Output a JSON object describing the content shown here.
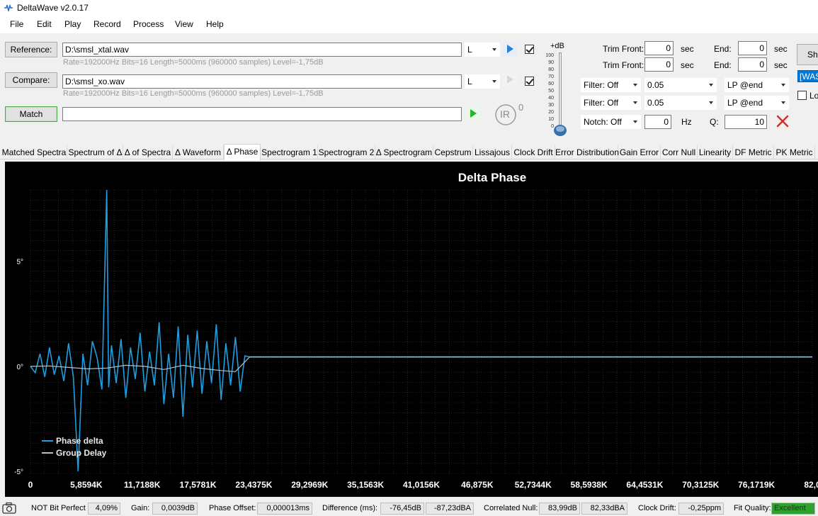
{
  "window": {
    "title": "DeltaWave v2.0.17"
  },
  "menu": [
    "File",
    "Edit",
    "Play",
    "Record",
    "Process",
    "View",
    "Help"
  ],
  "reference": {
    "button": "Reference:",
    "path": "D:\\smsl_xtal.wav",
    "channel": "L",
    "info": "Rate=192000Hz Bits=16 Length=5000ms (960000 samples) Level=-1,75dB",
    "checked": true
  },
  "compare": {
    "button": "Compare:",
    "path": "D:\\smsl_xo.wav",
    "channel": "L",
    "info": "Rate=192000Hz Bits=16 Length=5000ms (960000 samples) Level=-1,75dB",
    "checked": true
  },
  "match": {
    "button": "Match",
    "field": ""
  },
  "ir": {
    "label": "IR",
    "superscript": "0"
  },
  "db_slider": {
    "label": "+dB",
    "ticks": [
      "100",
      "90",
      "80",
      "70",
      "60",
      "50",
      "40",
      "30",
      "20",
      "10",
      "0"
    ],
    "value": 0
  },
  "trim": [
    {
      "label": "Trim Front:",
      "value": "0",
      "unit": "sec",
      "end_label": "End:",
      "end_value": "0",
      "end_unit": "sec"
    },
    {
      "label": "Trim Front:",
      "value": "0",
      "unit": "sec",
      "end_label": "End:",
      "end_value": "0",
      "end_unit": "sec"
    }
  ],
  "filters": [
    {
      "filter": "Filter: Off",
      "value": "0.05",
      "mode": "LP @end"
    },
    {
      "filter": "Filter: Off",
      "value": "0.05",
      "mode": "LP @end"
    }
  ],
  "notch": {
    "label": "Notch: Off",
    "value": "0",
    "unit": "Hz",
    "q_label": "Q:",
    "q_value": "10"
  },
  "right_edge": {
    "button": "Sh",
    "selected": "[WAS",
    "checkbox_label": "Lo"
  },
  "tabs": [
    "Matched Spectra",
    "Spectrum of Δ",
    "Δ of Spectra",
    "Δ Waveform",
    "Δ Phase",
    "Spectrogram 1",
    "Spectrogram 2",
    "Δ Spectrogram",
    "Cepstrum",
    "Lissajous",
    "Clock Drift",
    "Error Distribution",
    "Gain Error",
    "Corr Null",
    "Linearity",
    "DF Metric",
    "PK Metric"
  ],
  "active_tab": 4,
  "colors": {
    "phase_delta": "#1e9ee0",
    "group_delay": "#bfbfbf",
    "grid": "#3a3a3a",
    "background": "#000000",
    "fit_quality": "#2ea12e"
  },
  "chart_data": {
    "type": "line",
    "title": "Delta Phase",
    "xlabel": "",
    "ylabel": "",
    "x_tick_labels": [
      "0",
      "5,8594K",
      "11,7188K",
      "17,5781K",
      "23,4375K",
      "29,2969K",
      "35,1563K",
      "41,0156K",
      "46,875K",
      "52,7344K",
      "58,5938K",
      "64,4531K",
      "70,3125K",
      "76,1719K",
      "82,0"
    ],
    "x_ticks": [
      0,
      5859.4,
      11718.8,
      17578.1,
      23437.5,
      29296.9,
      35156.3,
      41015.6,
      46875,
      52734.4,
      58593.8,
      64453.1,
      70312.5,
      76171.9,
      82031.3
    ],
    "y_tick_labels": [
      "5°",
      "0°",
      "-5°"
    ],
    "y_ticks": [
      5,
      0,
      -5
    ],
    "xlim": [
      0,
      82031.3
    ],
    "ylim": [
      -5.1,
      8.4
    ],
    "grid": true,
    "legend_position": "bottom-left",
    "series": [
      {
        "name": "Phase delta",
        "x": [
          0,
          500,
          1000,
          1500,
          2000,
          2500,
          3000,
          3500,
          4000,
          4500,
          5000,
          5500,
          6000,
          6500,
          7000,
          7500,
          8000,
          8200,
          8500,
          9000,
          9500,
          10000,
          10500,
          11000,
          11500,
          12000,
          12500,
          13000,
          13500,
          14000,
          14500,
          15000,
          15500,
          16000,
          16500,
          17000,
          17500,
          18000,
          18500,
          19000,
          19500,
          20000,
          20500,
          21000,
          21500,
          22000,
          22500,
          23000,
          30000,
          40000,
          50000,
          60000,
          70000,
          82031.3
        ],
        "y": [
          0,
          -0.3,
          0.6,
          -0.5,
          0.9,
          -0.4,
          0.5,
          -0.7,
          1.1,
          -0.5,
          -5.0,
          0.6,
          -0.9,
          1.2,
          0.4,
          -1.1,
          8.4,
          -1.0,
          1.0,
          -0.8,
          1.3,
          -1.5,
          0.9,
          -0.6,
          1.6,
          -1.2,
          0.7,
          -0.9,
          2.1,
          -1.8,
          0.6,
          -1.5,
          1.9,
          -2.4,
          1.5,
          -1.0,
          1.7,
          -1.3,
          1.2,
          -0.8,
          2.0,
          -1.6,
          1.1,
          -0.9,
          1.4,
          -1.2,
          0.5,
          0.45,
          0.45,
          0.45,
          0.45,
          0.45,
          0.45,
          0.45
        ]
      },
      {
        "name": "Group Delay",
        "x": [
          0,
          2000,
          4000,
          6000,
          8000,
          10000,
          12000,
          14000,
          16000,
          18000,
          20000,
          21500,
          23000,
          82031.3
        ],
        "y": [
          0,
          0.02,
          -0.05,
          -0.12,
          -0.08,
          0.05,
          0.0,
          -0.15,
          0.05,
          -0.1,
          -0.2,
          -0.25,
          0.45,
          0.45
        ]
      }
    ]
  },
  "status": {
    "bit_perfect": "NOT Bit Perfect",
    "bit_perfect_value": "4,09%",
    "gain_label": "Gain:",
    "gain_value": "0,0039dB",
    "phase_offset_label": "Phase Offset:",
    "phase_offset_value": "0,000013ms",
    "difference_label": "Difference (ms):",
    "difference_value1": "-76,45dB",
    "difference_value2": "-87,23dBA",
    "corr_null_label": "Correlated Null:",
    "corr_null_value1": "83,99dB",
    "corr_null_value2": "82,33dBA",
    "clock_drift_label": "Clock Drift:",
    "clock_drift_value": "-0,25ppm",
    "fit_quality_label": "Fit Quality:",
    "fit_quality_value": "Excellent"
  }
}
